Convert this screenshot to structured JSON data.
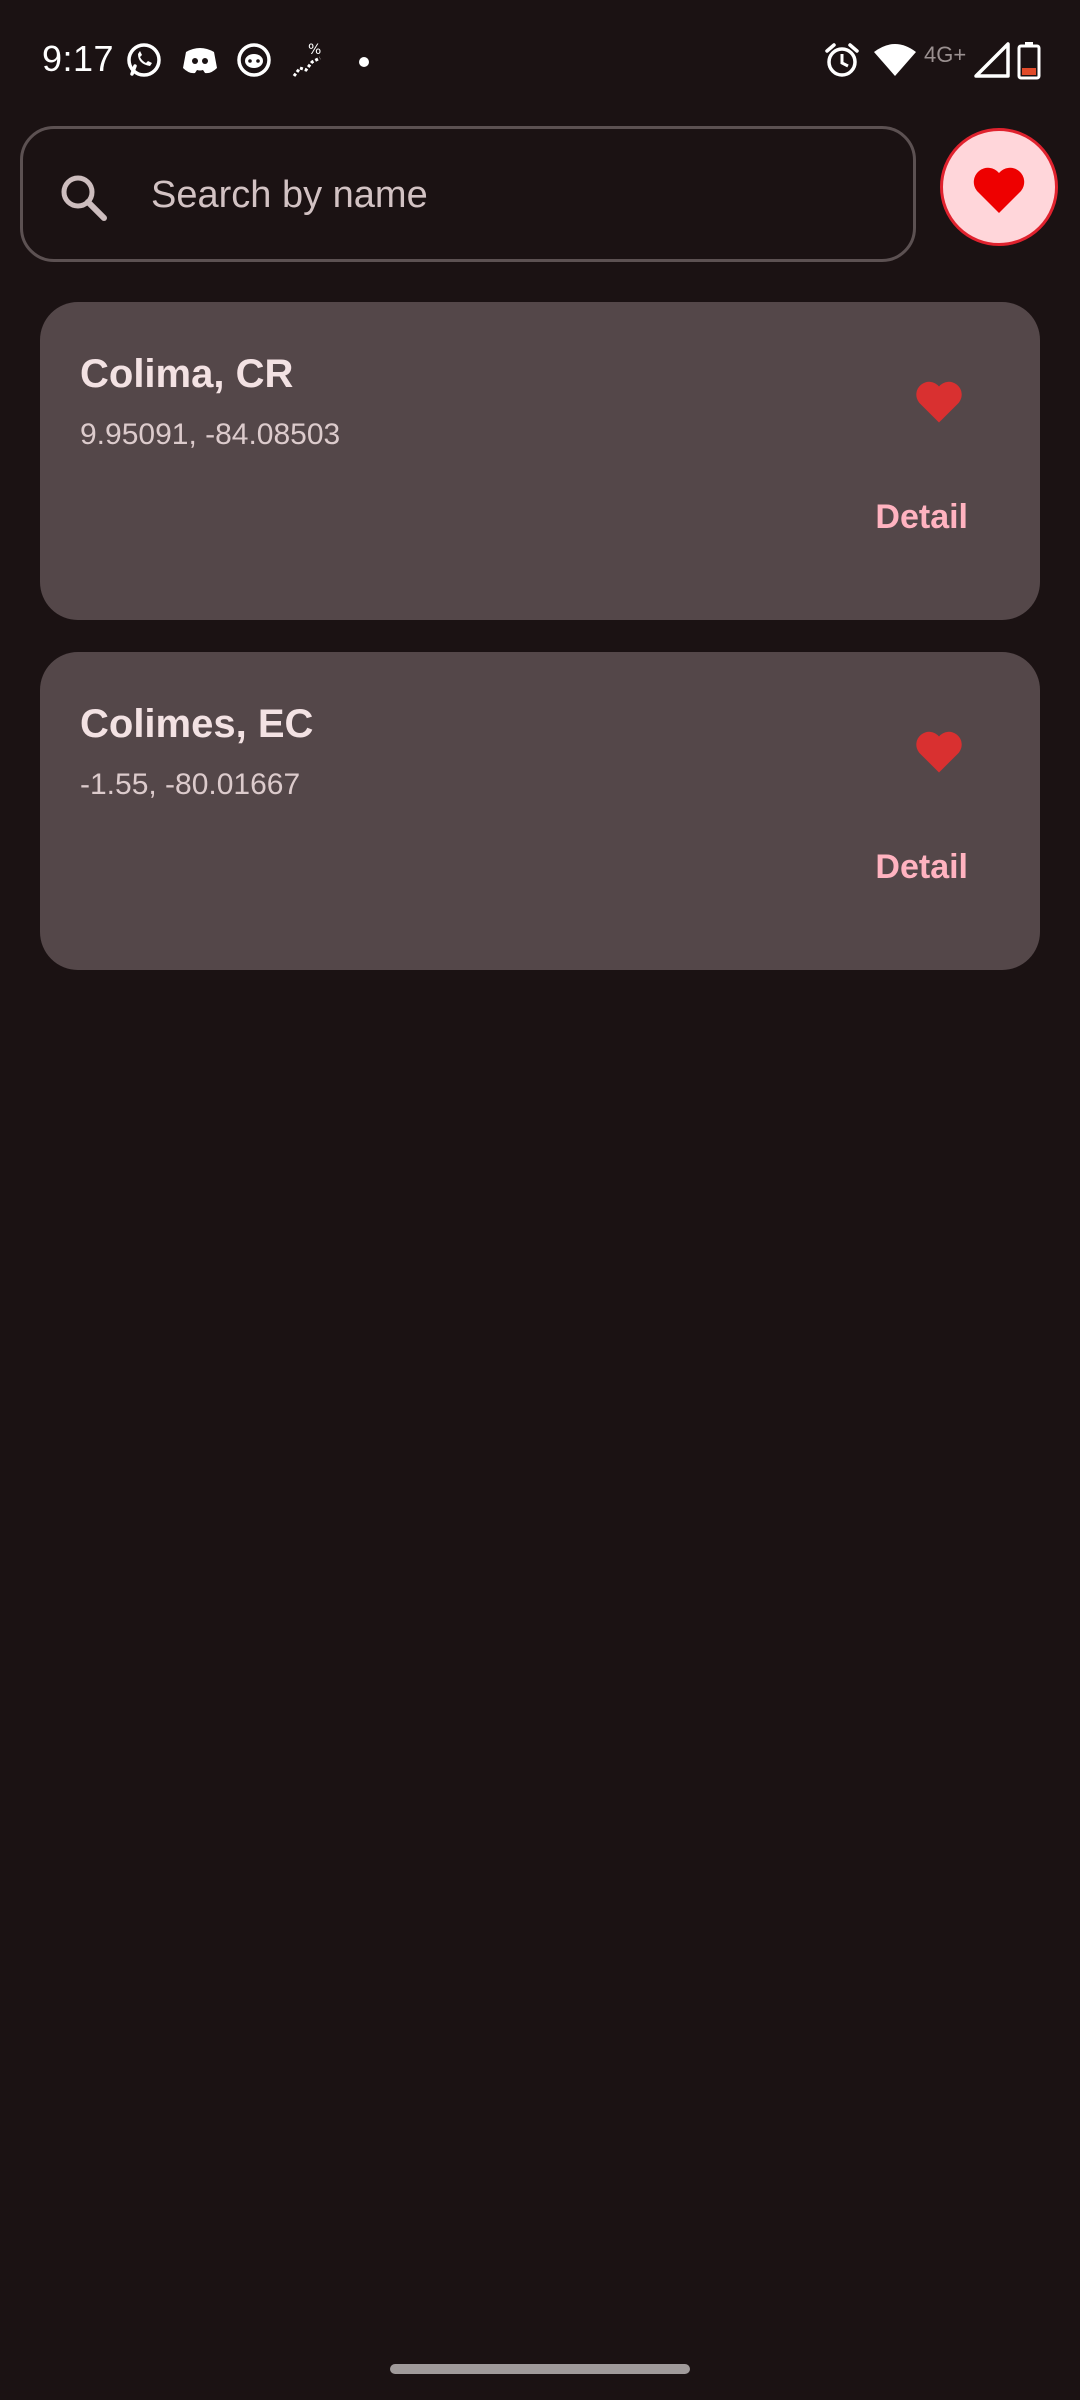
{
  "status_bar": {
    "time": "9:17",
    "network_type": "4G+",
    "icons": [
      "whatsapp-icon",
      "discord-icon",
      "github-icon",
      "app-icon",
      "dot-icon",
      "alarm-icon",
      "wifi-icon",
      "signal-icon",
      "battery-icon"
    ]
  },
  "search": {
    "placeholder": "Search by name",
    "value": ""
  },
  "favorites_button": {
    "icon": "heart-icon",
    "background": "#ffd6da",
    "border": "#e0222e"
  },
  "locations": [
    {
      "name": "Colima, CR",
      "coordinates": "9.95091, -84.08503",
      "favorite": true,
      "detail_label": "Detail"
    },
    {
      "name": "Colimes, EC",
      "coordinates": "-1.55, -80.01667",
      "favorite": true,
      "detail_label": "Detail"
    }
  ],
  "colors": {
    "background": "#1b1213",
    "card": "#544749",
    "accent_heart": "#d93030",
    "detail_text": "#ffb3c0"
  }
}
